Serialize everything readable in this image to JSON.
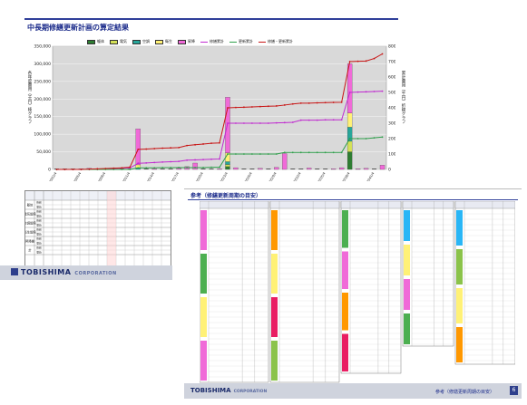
{
  "slide1": {
    "title": "中長期修繕更新計画の算定結果",
    "y_left_label": "各年度費用（千円）棒グラフ",
    "y_right_label": "累計費用（千円）折線グラフ",
    "legend": [
      {
        "label": "躯体",
        "color": "#2e7d32",
        "kind": "bar"
      },
      {
        "label": "電気",
        "color": "#d4e157",
        "kind": "bar"
      },
      {
        "label": "空調",
        "color": "#26a69a",
        "kind": "bar"
      },
      {
        "label": "衛生",
        "color": "#fff176",
        "kind": "bar"
      },
      {
        "label": "昇降",
        "color": "#f06ad8",
        "kind": "bar"
      },
      {
        "label": "修繕累計",
        "color": "#c02ad0",
        "kind": "line"
      },
      {
        "label": "更新累計",
        "color": "#2e9e4a",
        "kind": "line"
      },
      {
        "label": "修繕・更新累計",
        "color": "#c81414",
        "kind": "line"
      }
    ]
  },
  "chart_data": {
    "type": "bar",
    "left_ticks": [
      "350,000",
      "300,000",
      "250,000",
      "200,000",
      "150,000",
      "100,000",
      "50,000",
      "0"
    ],
    "right_ticks": [
      "800,000",
      "700,000",
      "600,000",
      "500,000",
      "400,000",
      "300,000",
      "200,000",
      "100,000",
      "0"
    ],
    "ylim_left": [
      0,
      350000
    ],
    "ylim_right": [
      0,
      800000
    ],
    "categories": [
      "2002/4",
      "2003/4",
      "2004/4",
      "2005/4",
      "2006/4",
      "2007/4",
      "2008/4",
      "2009/4",
      "2010/4",
      "2011/4",
      "2012/4",
      "2013/4",
      "2014/4",
      "2015/4",
      "2016/4",
      "2017/4",
      "2018/4",
      "2019/4",
      "2020/4",
      "2021/4",
      "2022/4",
      "2023/4",
      "2024/4",
      "2025/4",
      "2026/4",
      "2027/4",
      "2028/4",
      "2029/4",
      "2030/4",
      "2031/4",
      "2032/4",
      "2033/4",
      "2034/4",
      "2035/4",
      "2036/4",
      "2037/4",
      "2038/4",
      "2039/4",
      "2040/4",
      "2041/4",
      "2042/4"
    ],
    "stack": [
      {
        "name": "躯体",
        "color": "#2e7d32",
        "values": [
          0,
          0,
          0,
          0,
          0,
          0,
          0,
          0,
          0,
          0,
          0,
          0,
          0,
          0,
          0,
          0,
          0,
          0,
          0,
          0,
          0,
          8000,
          0,
          0,
          0,
          0,
          0,
          0,
          0,
          0,
          0,
          0,
          0,
          0,
          0,
          0,
          50000,
          0,
          0,
          0,
          0
        ]
      },
      {
        "name": "電気",
        "color": "#d4e157",
        "values": [
          0,
          0,
          0,
          0,
          0,
          0,
          0,
          0,
          0,
          0,
          0,
          0,
          0,
          0,
          0,
          0,
          0,
          0,
          0,
          0,
          0,
          6000,
          0,
          0,
          0,
          0,
          0,
          0,
          0,
          0,
          0,
          0,
          0,
          0,
          0,
          0,
          30000,
          0,
          0,
          0,
          0
        ]
      },
      {
        "name": "空調",
        "color": "#26a69a",
        "values": [
          0,
          0,
          0,
          0,
          0,
          0,
          0,
          0,
          0,
          0,
          5000,
          0,
          0,
          0,
          0,
          0,
          0,
          0,
          0,
          0,
          0,
          8000,
          0,
          0,
          0,
          0,
          0,
          0,
          0,
          0,
          0,
          0,
          0,
          0,
          0,
          0,
          40000,
          0,
          0,
          0,
          0
        ]
      },
      {
        "name": "衛生",
        "color": "#fff176",
        "values": [
          0,
          0,
          0,
          0,
          0,
          0,
          0,
          0,
          0,
          0,
          8000,
          0,
          0,
          0,
          0,
          0,
          0,
          0,
          0,
          0,
          0,
          25000,
          0,
          0,
          0,
          0,
          0,
          0,
          0,
          0,
          0,
          0,
          0,
          0,
          0,
          0,
          40000,
          0,
          0,
          0,
          0
        ]
      },
      {
        "name": "昇降",
        "color": "#f06ad8",
        "values": [
          0,
          0,
          0,
          2000,
          3000,
          0,
          0,
          1000,
          0,
          0,
          102000,
          0,
          2000,
          0,
          0,
          3000,
          8000,
          18000,
          0,
          0,
          2000,
          158000,
          5000,
          0,
          0,
          3000,
          0,
          6000,
          45000,
          0,
          0,
          4000,
          0,
          0,
          2000,
          5000,
          140000,
          2000,
          3000,
          0,
          12000
        ]
      }
    ],
    "series": [
      {
        "name": "修繕累計",
        "color": "#c02ad0",
        "values": [
          0,
          0,
          0,
          0,
          0,
          0,
          2000,
          6000,
          8000,
          10000,
          40000,
          42000,
          45000,
          48000,
          50000,
          52000,
          60000,
          62000,
          64000,
          66000,
          68000,
          300000,
          300000,
          300000,
          300000,
          300000,
          300000,
          302000,
          304000,
          306000,
          320000,
          320000,
          320000,
          322000,
          322000,
          322000,
          500000,
          502000,
          504000,
          506000,
          508000
        ]
      },
      {
        "name": "更新累計",
        "color": "#2e9e4a",
        "values": [
          0,
          0,
          0,
          0,
          0,
          0,
          0,
          0,
          0,
          0,
          10000,
          10000,
          10000,
          12000,
          12000,
          12000,
          12000,
          12000,
          12000,
          14000,
          14000,
          100000,
          100000,
          100000,
          100000,
          100000,
          100000,
          100000,
          110000,
          110000,
          110000,
          110000,
          110000,
          110000,
          110000,
          110000,
          200000,
          200000,
          200000,
          205000,
          210000
        ]
      },
      {
        "name": "修繕・更新累計",
        "color": "#c81414",
        "values": [
          0,
          0,
          0,
          0,
          2000,
          4000,
          6000,
          8000,
          10000,
          15000,
          130000,
          132000,
          135000,
          138000,
          140000,
          142000,
          155000,
          160000,
          165000,
          170000,
          172000,
          400000,
          402000,
          404000,
          406000,
          408000,
          410000,
          412000,
          418000,
          425000,
          430000,
          430000,
          432000,
          434000,
          435000,
          436000,
          700000,
          702000,
          704000,
          720000,
          750000
        ]
      }
    ]
  },
  "table1": {
    "row_labels": [
      "躯体",
      "電気設備",
      "空調設備",
      "衛生設備",
      "昇降機",
      "計"
    ],
    "sub_labels": [
      "修繕",
      "更新"
    ]
  },
  "logo": {
    "text": "TOBISHIMA",
    "sub": "CORPORATION"
  },
  "slide2": {
    "title": "参考（修繕更新周期の目安）",
    "footer_logo": "TOBISHIMA",
    "footer_sub": "CORPORATION",
    "footer_right": "参考（修繕更新周期の目安）",
    "page": "6"
  }
}
